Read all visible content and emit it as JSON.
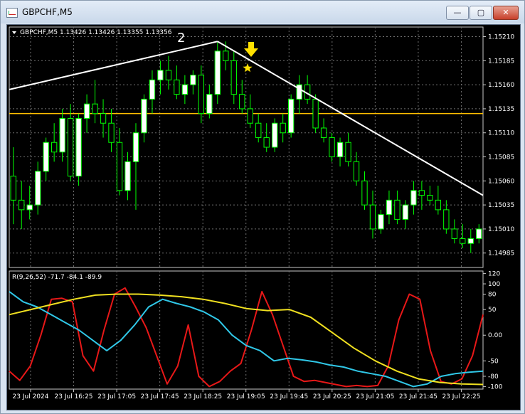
{
  "window": {
    "title": "GBPCHF,M5",
    "minimize_label": "—",
    "maximize_label": "▢",
    "close_label": "✕"
  },
  "chart": {
    "info_label": "GBPCHF,M5  1.13426 1.13426 1.13355 1.13356",
    "wave_label": "2",
    "price_ticks": [
      "1.15210",
      "1.15185",
      "1.15160",
      "1.15135",
      "1.15110",
      "1.15085",
      "1.15060",
      "1.15035",
      "1.15010",
      "1.14985"
    ],
    "time_ticks": [
      "23 Jul 2024",
      "23 Jul 16:25",
      "23 Jul 17:05",
      "23 Jul 17:45",
      "23 Jul 18:25",
      "23 Jul 19:05",
      "23 Jul 19:45",
      "23 Jul 20:25",
      "23 Jul 21:05",
      "23 Jul 21:45",
      "23 Jul 22:25"
    ]
  },
  "indicator": {
    "label": "R(9,26,52) -71.7 -84.1 -89.9",
    "ticks": [
      "120",
      "100",
      "80",
      "50",
      "0.00",
      "-50",
      "-80",
      "-100"
    ]
  },
  "colors": {
    "background": "#000000",
    "candles": "#00ff00",
    "bull_fill": "#ffffff",
    "trendline": "#ffffff",
    "level_line": "#ffc000",
    "grid": "#707070",
    "fast_line": "#e81818",
    "mid_line": "#30c8e8",
    "slow_line": "#f0e020",
    "marker": "#ffe000"
  },
  "chart_data": {
    "type": "candlestick",
    "symbol": "GBPCHF",
    "timeframe": "M5",
    "ylim": [
      1.1497,
      1.1522
    ],
    "level": 1.1513,
    "ohlc": [
      [
        1.15065,
        1.15095,
        1.15015,
        1.1504
      ],
      [
        1.1504,
        1.1506,
        1.1501,
        1.1503
      ],
      [
        1.1503,
        1.15055,
        1.1502,
        1.15035
      ],
      [
        1.15035,
        1.1508,
        1.15025,
        1.1507
      ],
      [
        1.1507,
        1.15105,
        1.1506,
        1.151
      ],
      [
        1.151,
        1.1512,
        1.1508,
        1.1509
      ],
      [
        1.1509,
        1.15135,
        1.1508,
        1.15125
      ],
      [
        1.15125,
        1.1514,
        1.1506,
        1.15065
      ],
      [
        1.15065,
        1.1513,
        1.15055,
        1.15125
      ],
      [
        1.15125,
        1.1515,
        1.1511,
        1.1514
      ],
      [
        1.1514,
        1.15165,
        1.1512,
        1.1513
      ],
      [
        1.1513,
        1.15145,
        1.15105,
        1.1512
      ],
      [
        1.1512,
        1.15135,
        1.1509,
        1.151
      ],
      [
        1.151,
        1.15115,
        1.15045,
        1.1505
      ],
      [
        1.1505,
        1.1509,
        1.1504,
        1.1508
      ],
      [
        1.1508,
        1.1512,
        1.1503,
        1.1511
      ],
      [
        1.1511,
        1.1515,
        1.151,
        1.15145
      ],
      [
        1.15145,
        1.15175,
        1.1513,
        1.15165
      ],
      [
        1.15165,
        1.15185,
        1.1515,
        1.15175
      ],
      [
        1.15175,
        1.1519,
        1.15155,
        1.15165
      ],
      [
        1.15165,
        1.1518,
        1.15145,
        1.1515
      ],
      [
        1.1515,
        1.1517,
        1.1514,
        1.1516
      ],
      [
        1.1516,
        1.15175,
        1.1515,
        1.1517
      ],
      [
        1.1517,
        1.1518,
        1.1512,
        1.1513
      ],
      [
        1.1513,
        1.1516,
        1.15125,
        1.1515
      ],
      [
        1.1515,
        1.15205,
        1.1514,
        1.15195
      ],
      [
        1.15195,
        1.15205,
        1.15175,
        1.15185
      ],
      [
        1.15185,
        1.15195,
        1.1514,
        1.1515
      ],
      [
        1.1515,
        1.15165,
        1.1513,
        1.15135
      ],
      [
        1.15135,
        1.1515,
        1.15115,
        1.1512
      ],
      [
        1.1512,
        1.1513,
        1.151,
        1.15105
      ],
      [
        1.15105,
        1.1512,
        1.1509,
        1.15095
      ],
      [
        1.15095,
        1.15125,
        1.1509,
        1.1512
      ],
      [
        1.1512,
        1.1513,
        1.151,
        1.1511
      ],
      [
        1.1511,
        1.1515,
        1.15105,
        1.15145
      ],
      [
        1.15145,
        1.1517,
        1.1513,
        1.1516
      ],
      [
        1.1516,
        1.1517,
        1.1514,
        1.15145
      ],
      [
        1.15145,
        1.1515,
        1.1511,
        1.15115
      ],
      [
        1.15115,
        1.15125,
        1.151,
        1.15105
      ],
      [
        1.15105,
        1.1511,
        1.1508,
        1.15085
      ],
      [
        1.15085,
        1.15105,
        1.15075,
        1.151
      ],
      [
        1.151,
        1.1511,
        1.15075,
        1.1508
      ],
      [
        1.1508,
        1.1509,
        1.15055,
        1.1506
      ],
      [
        1.1506,
        1.1507,
        1.1503,
        1.15035
      ],
      [
        1.15035,
        1.1505,
        1.15,
        1.1501
      ],
      [
        1.1501,
        1.1503,
        1.15005,
        1.15025
      ],
      [
        1.15025,
        1.1505,
        1.15015,
        1.1504
      ],
      [
        1.1504,
        1.1505,
        1.15015,
        1.1502
      ],
      [
        1.1502,
        1.1504,
        1.1501,
        1.15035
      ],
      [
        1.15035,
        1.1506,
        1.15025,
        1.1505
      ],
      [
        1.1505,
        1.1506,
        1.1503,
        1.15045
      ],
      [
        1.15045,
        1.15055,
        1.15035,
        1.1504
      ],
      [
        1.1504,
        1.15055,
        1.15025,
        1.1503
      ],
      [
        1.1503,
        1.1504,
        1.15005,
        1.1501
      ],
      [
        1.1501,
        1.1502,
        1.14995,
        1.15
      ],
      [
        1.15,
        1.15015,
        1.1499,
        1.14995
      ],
      [
        1.14995,
        1.1501,
        1.14985,
        1.15
      ],
      [
        1.15,
        1.15015,
        1.14995,
        1.1501
      ]
    ],
    "indicator_ylim": [
      -105,
      125
    ],
    "indicator_series": [
      {
        "values": [
          -70,
          -88,
          -60,
          0,
          70,
          72,
          65,
          -40,
          -70,
          10,
          80,
          92,
          55,
          15,
          -40,
          -95,
          -60,
          20,
          -80,
          -100,
          -90,
          -70,
          -55,
          10,
          85,
          40,
          -20,
          -80,
          -90,
          -88,
          -92,
          -96,
          -100,
          -98,
          -100,
          -98,
          -60,
          30,
          80,
          70,
          -30,
          -90,
          -95,
          -85,
          -40,
          40
        ]
      },
      {
        "values": [
          85,
          65,
          55,
          40,
          25,
          10,
          -10,
          -30,
          -10,
          20,
          55,
          70,
          62,
          55,
          45,
          30,
          0,
          -20,
          -30,
          -50,
          -45,
          -48,
          -52,
          -58,
          -62,
          -70,
          -75,
          -80,
          -90,
          -100,
          -95,
          -80,
          -75,
          -72,
          -70
        ]
      },
      {
        "values": [
          40,
          50,
          60,
          70,
          78,
          80,
          80,
          78,
          75,
          70,
          62,
          52,
          48,
          50,
          35,
          5,
          -25,
          -50,
          -70,
          -85,
          -92,
          -95,
          -96
        ]
      }
    ]
  }
}
